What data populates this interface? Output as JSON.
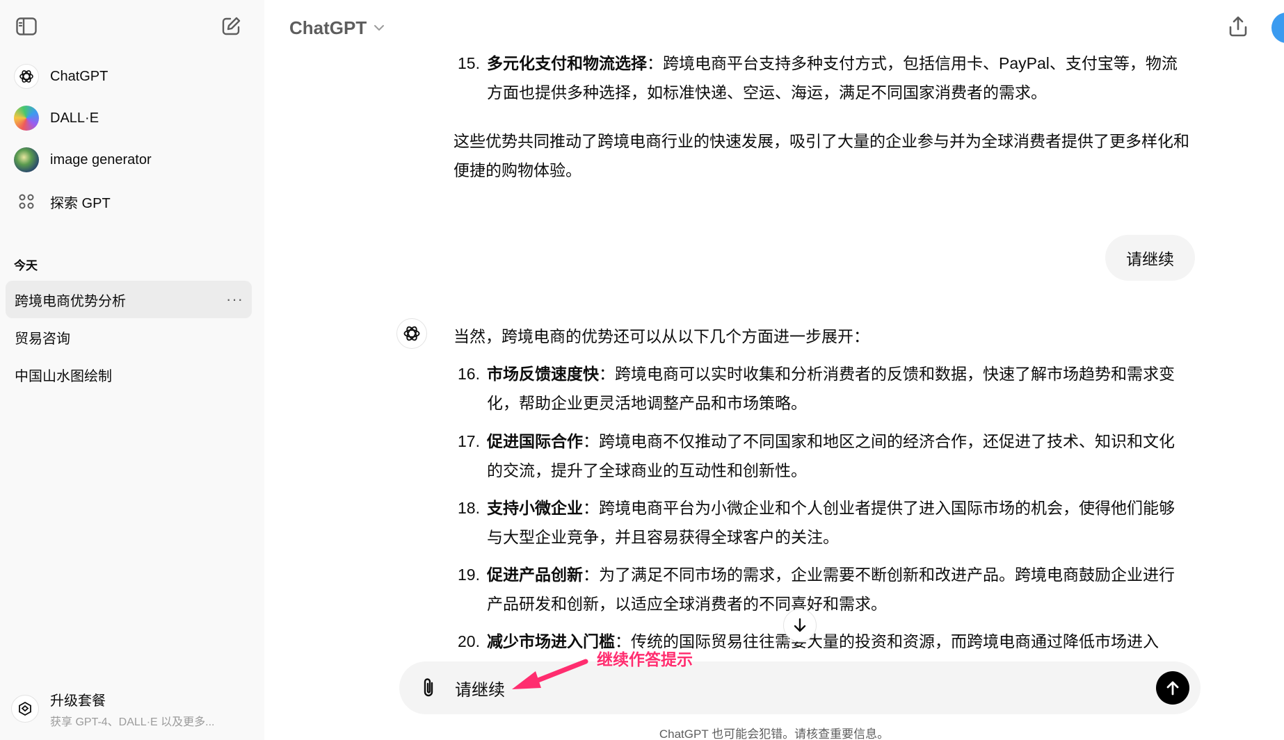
{
  "sidebar": {
    "toggle_icon": "sidebar-toggle-icon",
    "new_chat_icon": "new-chat-icon",
    "gpts": [
      {
        "label": "ChatGPT",
        "icon": "openai-logo-icon"
      },
      {
        "label": "DALL·E",
        "icon": "dalle-avatar"
      },
      {
        "label": "image generator",
        "icon": "image-generator-avatar"
      },
      {
        "label": "探索 GPT",
        "icon": "grid-icon"
      }
    ],
    "section_title": "今天",
    "history": [
      {
        "label": "跨境电商优势分析",
        "more": "···"
      },
      {
        "label": "贸易咨询"
      },
      {
        "label": "中国山水图绘制"
      }
    ],
    "upgrade": {
      "title": "升级套餐",
      "subtitle": "获享 GPT-4、DALL·E 以及更多..."
    }
  },
  "header": {
    "model": "ChatGPT",
    "share_icon": "share-icon"
  },
  "thread": {
    "item15": {
      "num": "15.",
      "bold": "多元化支付和物流选择",
      "text": "：跨境电商平台支持多种支付方式，包括信用卡、PayPal、支付宝等，物流方面也提供多种选择，如标准快递、空运、海运，满足不同国家消费者的需求。"
    },
    "summary": "这些优势共同推动了跨境电商行业的快速发展，吸引了大量的企业参与并为全球消费者提供了更多样化和便捷的购物体验。",
    "user_message": "请继续",
    "assistant_intro": "当然，跨境电商的优势还可以从以下几个方面进一步展开：",
    "items": [
      {
        "num": "16.",
        "bold": "市场反馈速度快",
        "text": "：跨境电商可以实时收集和分析消费者的反馈和数据，快速了解市场趋势和需求变化，帮助企业更灵活地调整产品和市场策略。"
      },
      {
        "num": "17.",
        "bold": "促进国际合作",
        "text": "：跨境电商不仅推动了不同国家和地区之间的经济合作，还促进了技术、知识和文化的交流，提升了全球商业的互动性和创新性。"
      },
      {
        "num": "18.",
        "bold": "支持小微企业",
        "text": "：跨境电商平台为小微企业和个人创业者提供了进入国际市场的机会，使得他们能够与大型企业竞争，并且容易获得全球客户的关注。"
      },
      {
        "num": "19.",
        "bold": "促进产品创新",
        "text": "：为了满足不同市场的需求，企业需要不断创新和改进产品。跨境电商鼓励企业进行产品研发和创新，以适应全球消费者的不同喜好和需求。"
      },
      {
        "num": "20.",
        "bold": "减少市场进入门槛",
        "text": "：传统的国际贸易往往需要大量的投资和资源，而跨境电商通过降低市场进入"
      }
    ]
  },
  "composer": {
    "value": "请继续",
    "attach_icon": "paperclip-icon",
    "send_icon": "arrow-up-icon"
  },
  "disclaimer": "ChatGPT 也可能会犯错。请核查重要信息。",
  "annotation": {
    "label": "继续作答提示",
    "color": "#ff2d6f"
  }
}
